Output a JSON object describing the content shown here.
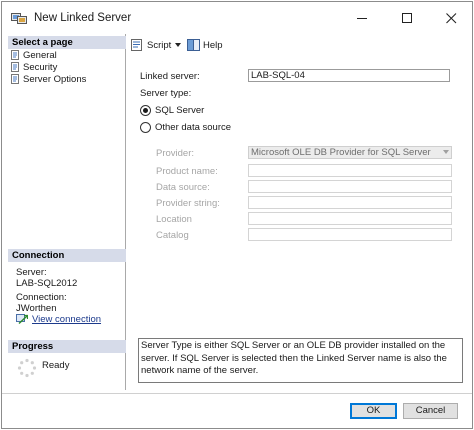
{
  "window": {
    "title": "New Linked Server",
    "controls": {
      "minimize_icon": "minimize-icon",
      "maximize_icon": "maximize-icon",
      "close_icon": "close-icon"
    }
  },
  "left_panel": {
    "select_page_header": "Select a page",
    "pages": [
      {
        "label": "General",
        "icon": "page-icon"
      },
      {
        "label": "Security",
        "icon": "page-icon"
      },
      {
        "label": "Server Options",
        "icon": "page-icon"
      }
    ],
    "connection_header": "Connection",
    "server_label": "Server:",
    "server_value": "LAB-SQL2012",
    "connection_label": "Connection:",
    "connection_value": "JWorthen",
    "view_connection_label": "View connection",
    "progress_header": "Progress",
    "progress_status": "Ready"
  },
  "toolbar": {
    "script_label": "Script",
    "help_label": "Help"
  },
  "form": {
    "linked_server_label": "Linked server:",
    "linked_server_value": "LAB-SQL-04",
    "server_type_label": "Server type:",
    "server_type_options": [
      {
        "label": "SQL Server",
        "selected": true
      },
      {
        "label": "Other data source",
        "selected": false
      }
    ],
    "provider_label": "Provider:",
    "provider_value": "Microsoft OLE DB Provider for SQL Server",
    "product_name_label": "Product name:",
    "product_name_value": "",
    "data_source_label": "Data source:",
    "data_source_value": "",
    "provider_string_label": "Provider string:",
    "provider_string_value": "",
    "location_label": "Location",
    "location_value": "",
    "catalog_label": "Catalog",
    "catalog_value": "",
    "info_text": "Server Type is either SQL Server or an OLE DB provider installed on the server. If SQL Server is selected then the Linked Server name is also the network name of the server."
  },
  "buttons": {
    "ok_label": "OK",
    "cancel_label": "Cancel"
  },
  "colors": {
    "section_header_bg": "#d6dbe9",
    "link_color": "#1c3a8c",
    "default_button_border": "#0078d7"
  }
}
